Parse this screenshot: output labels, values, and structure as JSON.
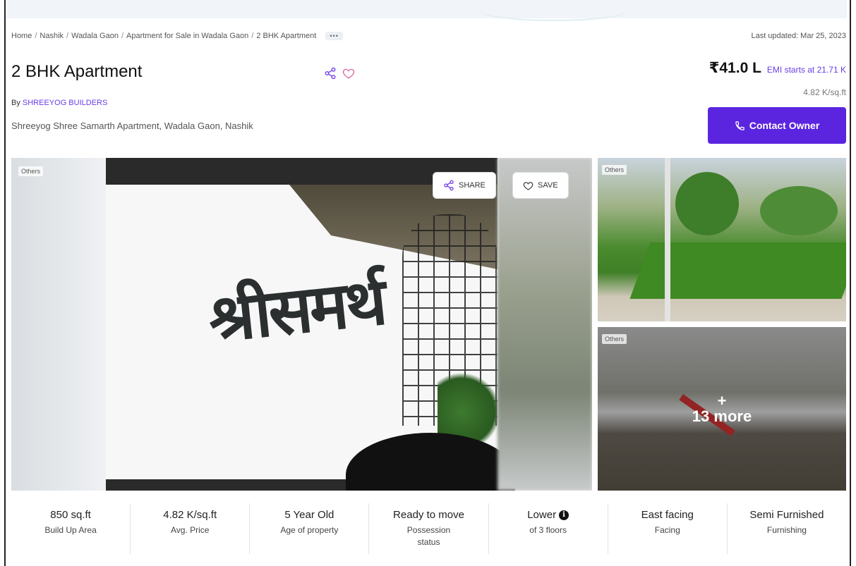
{
  "breadcrumb": {
    "items": [
      "Home",
      "Nashik",
      "Wadala Gaon",
      "Apartment for Sale in Wadala Gaon",
      "2 BHK Apartment"
    ],
    "more_label": "•••"
  },
  "last_updated": "Last updated: Mar 25, 2023",
  "listing": {
    "title": "2 BHK Apartment",
    "by_label": "By",
    "builder": "SHREEYOG BUILDERS",
    "address": "Shreeyog Shree Samarth Apartment, Wadala Gaon, Nashik"
  },
  "pricing": {
    "price": "₹41.0 L",
    "emi_label": "EMI starts at",
    "emi_value": "21.71 K",
    "per_sqft": "4.82 K/sq.ft"
  },
  "contact_button": "Contact Owner",
  "gallery": {
    "main_tag": "Others",
    "share_label": "SHARE",
    "save_label": "SAVE",
    "main_sign_text": "श्रीसमर्थ",
    "side_tags": [
      "Others",
      "Others"
    ],
    "more_plus": "+",
    "more_text": "13 more"
  },
  "stats": [
    {
      "value": "850 sq.ft",
      "label": "Build Up Area"
    },
    {
      "value": "4.82 K/sq.ft",
      "label": "Avg. Price"
    },
    {
      "value": "5 Year Old",
      "label": "Age of property"
    },
    {
      "value": "Ready to move",
      "label": "Possession status"
    },
    {
      "value": "Lower",
      "label": "of 3 floors"
    },
    {
      "value": "East facing",
      "label": "Facing"
    },
    {
      "value": "Semi Furnished",
      "label": "Furnishing"
    }
  ],
  "colors": {
    "accent": "#5b25e0",
    "link": "#6a3de8"
  },
  "icons": [
    "share-icon",
    "heart-icon",
    "phone-icon",
    "info-icon"
  ]
}
